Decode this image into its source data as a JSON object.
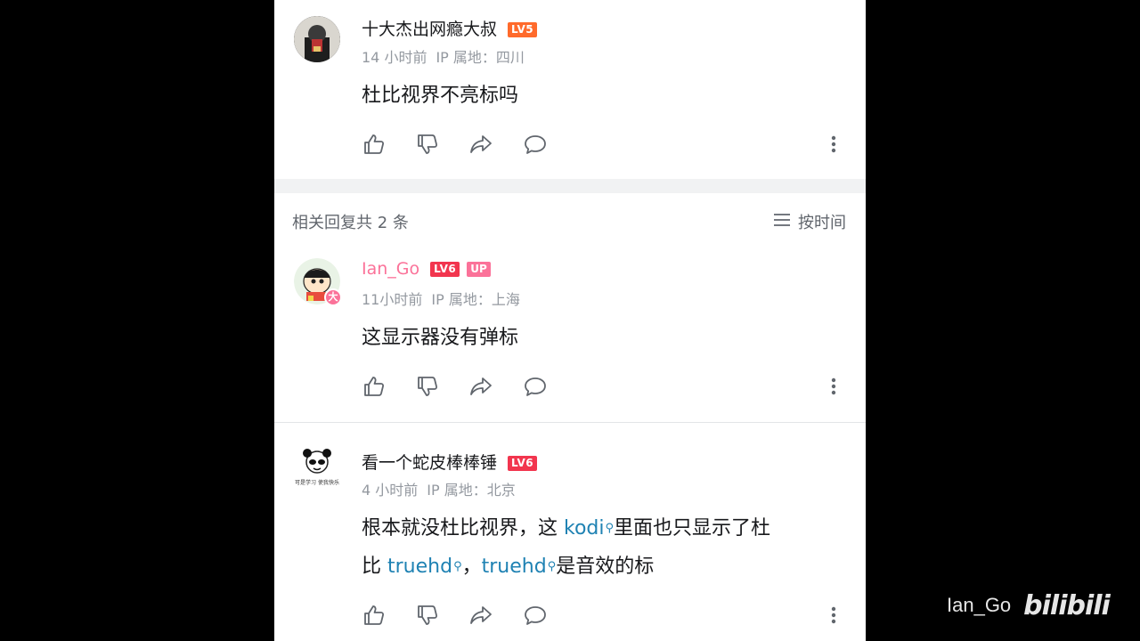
{
  "comments": [
    {
      "username": "十大杰出网瘾大叔",
      "level": "LV5",
      "time": "14 小时前",
      "ip": "IP 属地：四川",
      "text": "杜比视界不亮标吗"
    },
    {
      "username": "Ian_Go",
      "level": "LV6",
      "up_tag": "UP",
      "avatar_badge": "大",
      "time": "11小时前",
      "ip": "IP 属地：上海",
      "text": "这显示器没有弹标"
    },
    {
      "username": "看一个蛇皮棒棒锤",
      "level": "LV6",
      "avatar_caption": "可是学习 使我快乐",
      "time": "4 小时前",
      "ip": "IP 属地：北京",
      "text_line1_a": "根本就没杜比视界，这 ",
      "text_line1_kw": "kodi",
      "text_line1_b": "里面也只显示了杜",
      "text_line2_a": "比 ",
      "text_line2_kw1": "truehd",
      "text_line2_b": "，",
      "text_line2_kw2": "truehd",
      "text_line2_c": "是音效的标"
    }
  ],
  "replies_header": "相关回复共 2 条",
  "sort_label": "按时间",
  "watermark": {
    "user": "Ian_Go",
    "logo": "bilibili"
  },
  "icons": {
    "like": "thumb-up-icon",
    "dislike": "thumb-down-icon",
    "share": "share-icon",
    "reply": "comment-icon",
    "more": "more-vertical-icon",
    "sort": "sort-lines-icon",
    "search": "search-icon"
  },
  "colors": {
    "up_name": "#fb7299",
    "lv5": "#ff6a2b",
    "lv6": "#f2354e",
    "keyword": "#1f82b3",
    "meta": "#9499a0"
  }
}
